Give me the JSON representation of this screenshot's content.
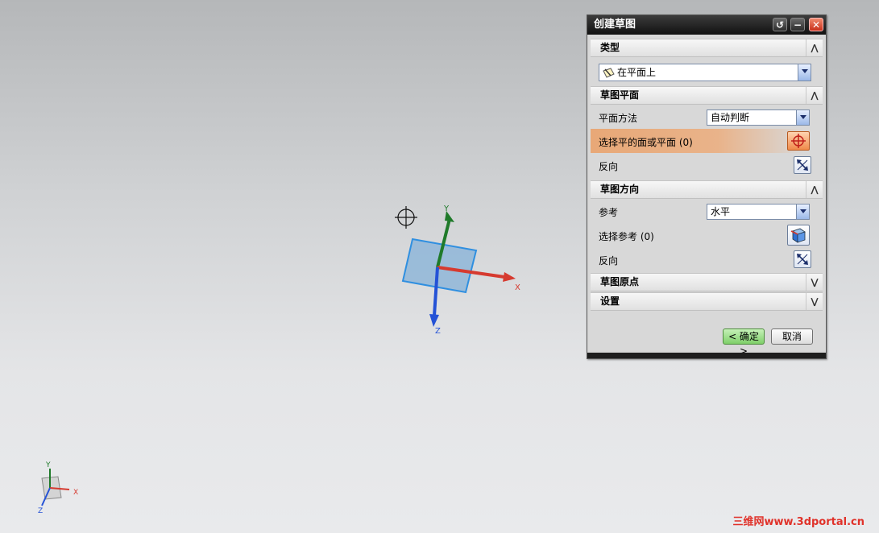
{
  "dialog": {
    "title": "创建草图",
    "sections": {
      "type": {
        "header": "类型",
        "selected": "在平面上"
      },
      "sketch_plane": {
        "header": "草图平面",
        "plane_method_label": "平面方法",
        "plane_method_value": "自动判断",
        "select_face_label": "选择平的面或平面 (0)",
        "reverse_label": "反向"
      },
      "sketch_orientation": {
        "header": "草图方向",
        "reference_label": "参考",
        "reference_value": "水平",
        "select_reference_label": "选择参考 (0)",
        "reverse_label": "反向"
      },
      "sketch_origin": {
        "header": "草图原点"
      },
      "settings": {
        "header": "设置"
      }
    },
    "ok_label": "< 确定 >",
    "cancel_label": "取消"
  },
  "viewport": {
    "axis_labels": {
      "x": "X",
      "y": "Y",
      "z": "Z"
    },
    "triad_labels": {
      "x": "X",
      "y": "Y",
      "z": "Z"
    }
  },
  "watermark": "三维网www.3dportal.cn",
  "colors": {
    "x_axis": "#d63a2f",
    "y_axis": "#1f7a2a",
    "z_axis": "#2452d6",
    "plane_fill": "#8fb6d8",
    "highlight": "#e8a877"
  }
}
